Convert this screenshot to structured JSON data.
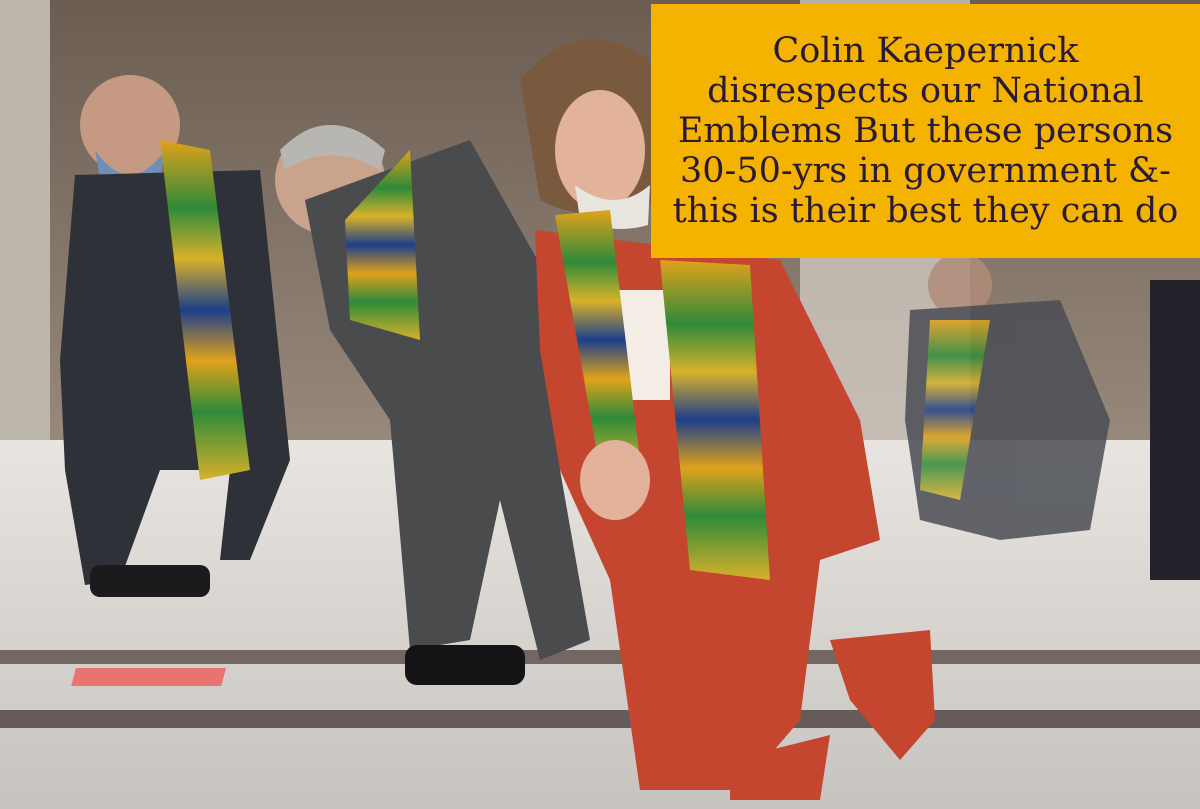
{
  "caption": {
    "lines": [
      "Colin Kaepernick",
      "disrespects our National",
      "Emblems But these persons",
      "30-50-yrs in government &-",
      "this is their best they can do"
    ],
    "background_color": "#f4b300",
    "text_color": "#2a1a3a"
  },
  "photo": {
    "colors": {
      "wall": "#8a7a6e",
      "floor": "#d9d6d2",
      "red_suit": "#c4462e",
      "dark_suit": "#2e3138",
      "grey_suit": "#4a4b4d"
    }
  }
}
